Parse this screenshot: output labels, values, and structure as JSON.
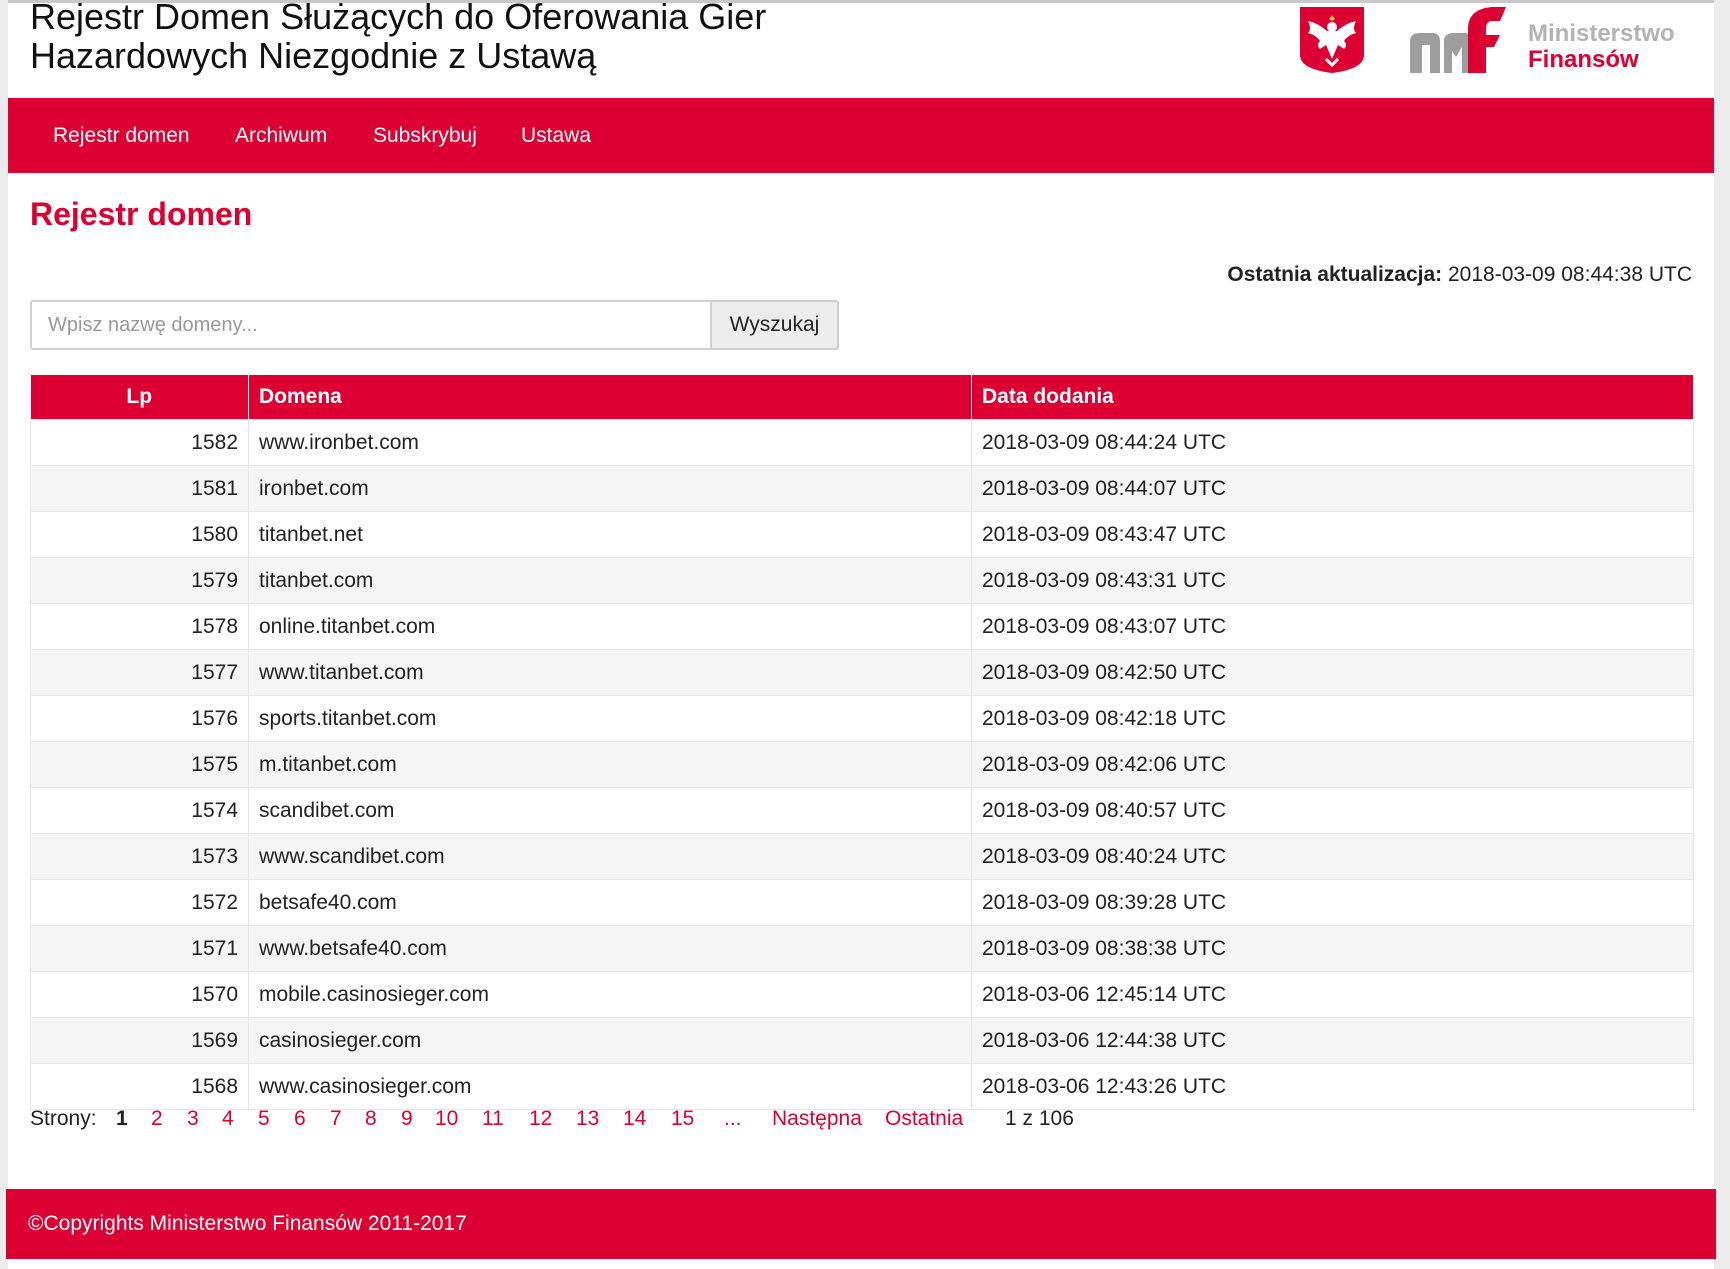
{
  "header": {
    "title_line1": "Rejestr Domen Służących do Oferowania Gier",
    "title_line2": "Hazardowych Niezgodnie z Ustawą",
    "logo_line1": "Ministerstwo",
    "logo_line2": "Finansów",
    "emblem_icon": "polish-eagle-emblem",
    "colors": {
      "brand": "#dc0032",
      "logo_gray": "#b3b3b3"
    }
  },
  "nav": {
    "items": [
      {
        "label": "Rejestr domen"
      },
      {
        "label": "Archiwum"
      },
      {
        "label": "Subskrybuj"
      },
      {
        "label": "Ustawa"
      }
    ]
  },
  "main": {
    "title": "Rejestr domen",
    "last_update_label": "Ostatnia aktualizacja:",
    "last_update_value": "2018-03-09 08:44:38 UTC",
    "search": {
      "placeholder": "Wpisz nazwę domeny...",
      "value": "",
      "button": "Wyszukaj"
    }
  },
  "table": {
    "columns": [
      "Lp",
      "Domena",
      "Data dodania"
    ],
    "rows": [
      {
        "lp": "1582",
        "domain": "www.ironbet.com",
        "date": "2018-03-09 08:44:24 UTC"
      },
      {
        "lp": "1581",
        "domain": "ironbet.com",
        "date": "2018-03-09 08:44:07 UTC"
      },
      {
        "lp": "1580",
        "domain": "titanbet.net",
        "date": "2018-03-09 08:43:47 UTC"
      },
      {
        "lp": "1579",
        "domain": "titanbet.com",
        "date": "2018-03-09 08:43:31 UTC"
      },
      {
        "lp": "1578",
        "domain": "online.titanbet.com",
        "date": "2018-03-09 08:43:07 UTC"
      },
      {
        "lp": "1577",
        "domain": "www.titanbet.com",
        "date": "2018-03-09 08:42:50 UTC"
      },
      {
        "lp": "1576",
        "domain": "sports.titanbet.com",
        "date": "2018-03-09 08:42:18 UTC"
      },
      {
        "lp": "1575",
        "domain": "m.titanbet.com",
        "date": "2018-03-09 08:42:06 UTC"
      },
      {
        "lp": "1574",
        "domain": "scandibet.com",
        "date": "2018-03-09 08:40:57 UTC"
      },
      {
        "lp": "1573",
        "domain": "www.scandibet.com",
        "date": "2018-03-09 08:40:24 UTC"
      },
      {
        "lp": "1572",
        "domain": "betsafe40.com",
        "date": "2018-03-09 08:39:28 UTC"
      },
      {
        "lp": "1571",
        "domain": "www.betsafe40.com",
        "date": "2018-03-09 08:38:38 UTC"
      },
      {
        "lp": "1570",
        "domain": "mobile.casinosieger.com",
        "date": "2018-03-06 12:45:14 UTC"
      },
      {
        "lp": "1569",
        "domain": "casinosieger.com",
        "date": "2018-03-06 12:44:38 UTC"
      },
      {
        "lp": "1568",
        "domain": "www.casinosieger.com",
        "date": "2018-03-06 12:43:26 UTC"
      }
    ]
  },
  "pagination": {
    "label": "Strony:",
    "current": "1",
    "pages": [
      "2",
      "3",
      "4",
      "5",
      "6",
      "7",
      "8",
      "9",
      "10",
      "11",
      "12",
      "13",
      "14",
      "15"
    ],
    "ellipsis": "...",
    "next": "Następna",
    "last": "Ostatnia",
    "count": "1 z 106"
  },
  "footer": {
    "copyright": "©Copyrights Ministerstwo Finansów 2011-2017"
  }
}
